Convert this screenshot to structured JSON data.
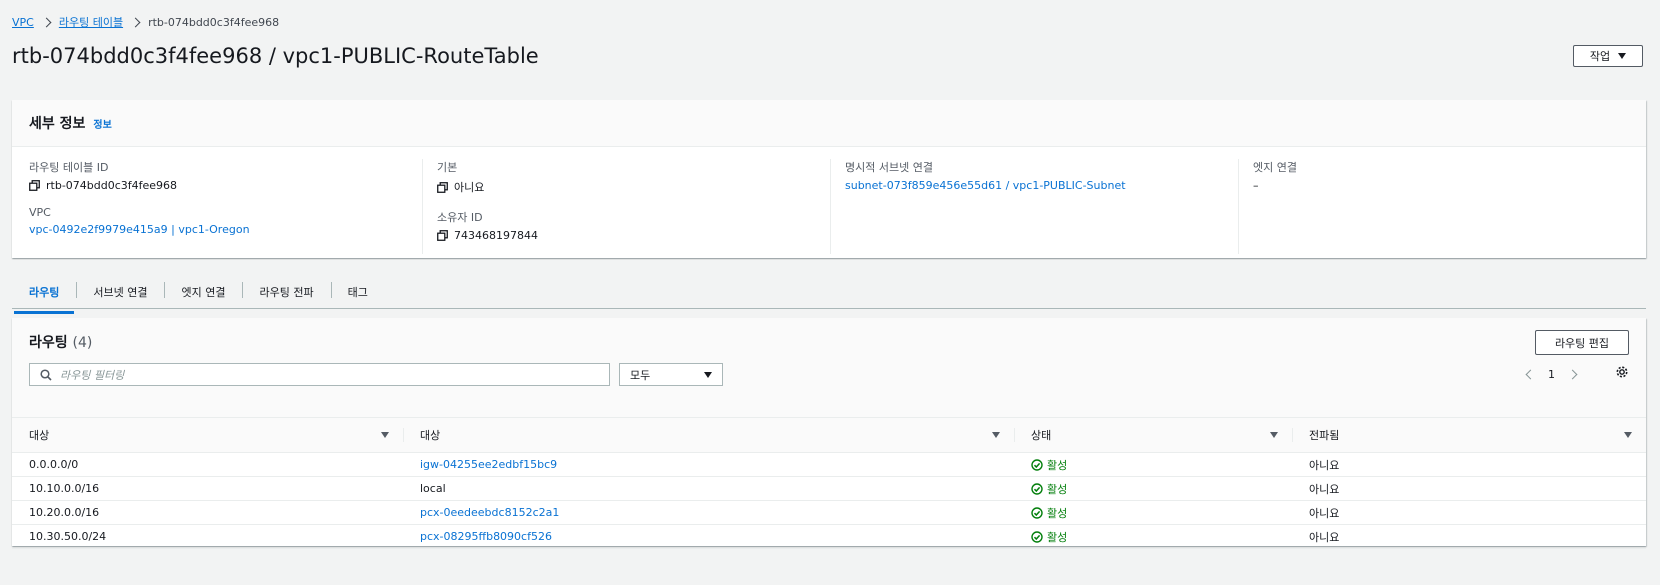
{
  "breadcrumb": {
    "vpc": "VPC",
    "route_tables": "라우팅 테이블",
    "current": "rtb-074bdd0c3f4fee968"
  },
  "page": {
    "title": "rtb-074bdd0c3f4fee968 / vpc1-PUBLIC-RouteTable",
    "actions_label": "작업"
  },
  "details": {
    "heading": "세부 정보",
    "info_link": "정보",
    "route_table_id_label": "라우팅 테이블 ID",
    "route_table_id": "rtb-074bdd0c3f4fee968",
    "vpc_label": "VPC",
    "vpc_value": "vpc-0492e2f9979e415a9 | vpc1-Oregon",
    "main_label": "기본",
    "main_value": "아니요",
    "owner_label": "소유자 ID",
    "owner_value": "743468197844",
    "explicit_subnet_label": "명시적 서브넷 연결",
    "explicit_subnet_value": "subnet-073f859e456e55d61 / vpc1-PUBLIC-Subnet",
    "edge_label": "엣지 연결",
    "edge_value": "–"
  },
  "tabs": [
    {
      "label": "라우팅"
    },
    {
      "label": "서브넷 연결"
    },
    {
      "label": "엣지 연결"
    },
    {
      "label": "라우팅 전파"
    },
    {
      "label": "태그"
    }
  ],
  "routes": {
    "heading": "라우팅",
    "count": "(4)",
    "edit_label": "라우팅 편집",
    "search_placeholder": "라우팅 필터링",
    "filter_value": "모두",
    "page_number": "1",
    "columns": [
      "대상",
      "대상",
      "상태",
      "전파됨"
    ],
    "rows": [
      {
        "destination": "0.0.0.0/0",
        "target": "igw-04255ee2edbf15bc9",
        "status": "활성",
        "propagated": "아니요"
      },
      {
        "destination": "10.10.0.0/16",
        "target": "local",
        "status": "활성",
        "propagated": "아니요"
      },
      {
        "destination": "10.20.0.0/16",
        "target": "pcx-0eedeebdc8152c2a1",
        "status": "활성",
        "propagated": "아니요"
      },
      {
        "destination": "10.30.50.0/24",
        "target": "pcx-08295ffb8090cf526",
        "status": "활성",
        "propagated": "아니요"
      }
    ]
  },
  "colors": {
    "link": "#0972d3",
    "success": "#037f0c",
    "background": "#f2f3f3"
  }
}
